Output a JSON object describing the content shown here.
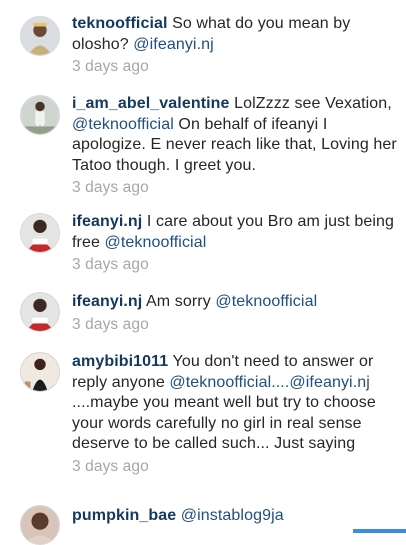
{
  "comments": [
    {
      "username": "teknoofficial",
      "text_before": " So what do you mean by olosho? ",
      "mention": "@ifeanyi.nj",
      "text_after": "",
      "time": "3 days ago"
    },
    {
      "username": "i_am_abel_valentine",
      "text_before": " LolZzzz see Vexation, ",
      "mention": "@teknoofficial",
      "text_after": " On behalf of ifeanyi I apologize. E never reach like that, Loving her Tatoo though. I greet you.",
      "time": "3 days ago"
    },
    {
      "username": "ifeanyi.nj",
      "text_before": " I care about you Bro am just being free ",
      "mention": "@teknoofficial",
      "text_after": "",
      "time": "3 days ago"
    },
    {
      "username": "ifeanyi.nj",
      "text_before": " Am sorry ",
      "mention": "@teknoofficial",
      "text_after": "",
      "time": "3 days ago"
    },
    {
      "username": "amybibi1011",
      "text_before": " You don't need to answer or reply anyone ",
      "mention": "@teknoofficial....@ifeanyi.nj",
      "text_after": " ....maybe you meant well but try to choose your words carefully no girl in real sense deserve to be called such... Just saying",
      "time": "3 days ago"
    },
    {
      "username": "pumpkin_bae",
      "text_before": " ",
      "mention": "@instablog9ja",
      "text_after": "",
      "time": ""
    }
  ],
  "colors": {
    "username": "#14385f",
    "mention": "#1e4f82",
    "timestamp": "#a5a7aa",
    "text": "#262626",
    "bottom_indicator": "#3b8fd9"
  },
  "icons": {
    "avatar": "profile-photo"
  }
}
